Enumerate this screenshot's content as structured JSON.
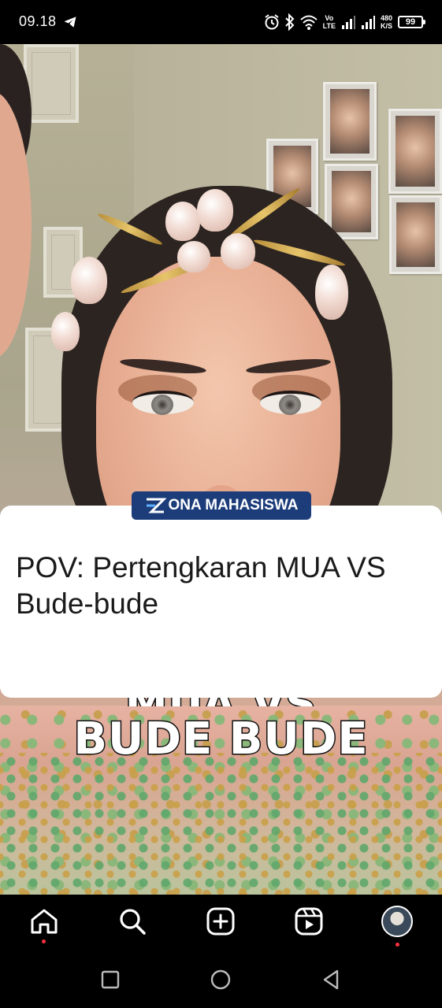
{
  "status_bar": {
    "time": "09.18",
    "network_label": "Vo\nLTE",
    "speed_value": "480",
    "speed_unit": "K/S",
    "battery": "99",
    "icons": [
      "telegram-icon",
      "alarm-icon",
      "bluetooth-icon",
      "wifi-icon",
      "signal-icon",
      "signal-icon",
      "battery-icon"
    ]
  },
  "post": {
    "badge_text": "ONA MAHASISWA",
    "caption": "POV: Pertengkaran MUA VS Bude-bude",
    "video_overlay_line1": "MUA VS",
    "video_overlay_line2": "BUDE BUDE"
  },
  "bottom_nav": {
    "items": [
      {
        "icon": "home-icon",
        "active": true
      },
      {
        "icon": "search-icon"
      },
      {
        "icon": "create-post-icon"
      },
      {
        "icon": "reels-icon"
      },
      {
        "icon": "profile-avatar",
        "notification": true
      }
    ]
  },
  "system_nav": {
    "items": [
      "recent-apps-icon",
      "home-circle-icon",
      "back-icon"
    ]
  },
  "colors": {
    "badge_bg": "#1c3d7a",
    "notification_dot": "#ff3040",
    "card_bg": "#ffffff"
  }
}
